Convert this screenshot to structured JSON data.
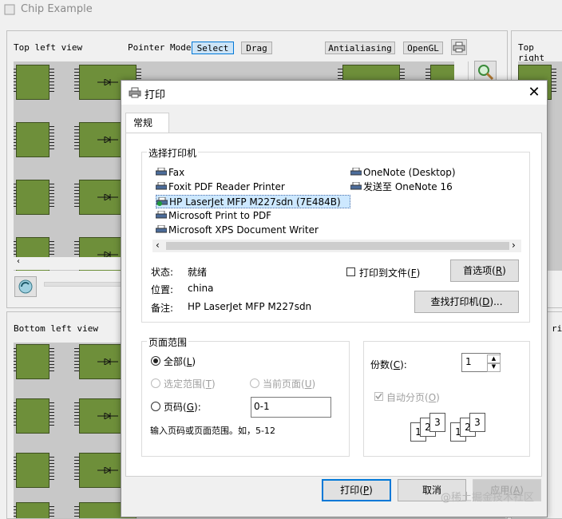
{
  "main_window": {
    "title": "Chip Example",
    "top_left": {
      "label": "Top left view",
      "pointer_mode_label": "Pointer Mode",
      "select_label": "Select",
      "drag_label": "Drag",
      "antialiasing_label": "Antialiasing",
      "opengl_label": "OpenGL"
    },
    "top_right_label": "Top right",
    "bottom_left_label": "Bottom left view",
    "bottom_right_label_partial": "ri"
  },
  "dialog": {
    "title": "打印",
    "close_glyph": "✕",
    "tab_label": "常规",
    "select_printer_label": "选择打印机",
    "printers_col1": [
      "Fax",
      "Foxit PDF Reader Printer",
      "HP LaserJet MFP M227sdn (7E484B)",
      "Microsoft Print to PDF",
      "Microsoft XPS Document Writer"
    ],
    "printers_col2": [
      "OneNote (Desktop)",
      "发送至 OneNote 16"
    ],
    "selected_printer_index": 2,
    "status_label": "状态:",
    "status_value": "就绪",
    "location_label": "位置:",
    "location_value": "china",
    "comment_label": "备注:",
    "comment_value": "HP LaserJet MFP M227sdn",
    "print_to_file_label": "打印到文件",
    "print_to_file_key": "F",
    "preferences_label": "首选项",
    "preferences_key": "R",
    "find_printer_label": "查找打印机",
    "find_printer_key": "D",
    "find_printer_suffix": "...",
    "page_range": {
      "group_label": "页面范围",
      "all_label": "全部",
      "all_key": "L",
      "selection_label": "选定范围",
      "selection_key": "T",
      "current_page_label": "当前页面",
      "current_page_key": "U",
      "pages_label": "页码",
      "pages_key": "G",
      "pages_value": "0-1",
      "hint": "输入页码或页面范围。如，5-12"
    },
    "copies": {
      "label": "份数",
      "key": "C",
      "value": "1",
      "collate_label": "自动分页",
      "collate_key": "O",
      "collate_checked": true
    },
    "collate_digits": [
      "1",
      "2",
      "3"
    ],
    "print_button": "打印",
    "print_key": "P",
    "cancel_button": "取消",
    "apply_button": "应用",
    "apply_key": "A"
  },
  "watermark": "@稀土掘金技术社区"
}
